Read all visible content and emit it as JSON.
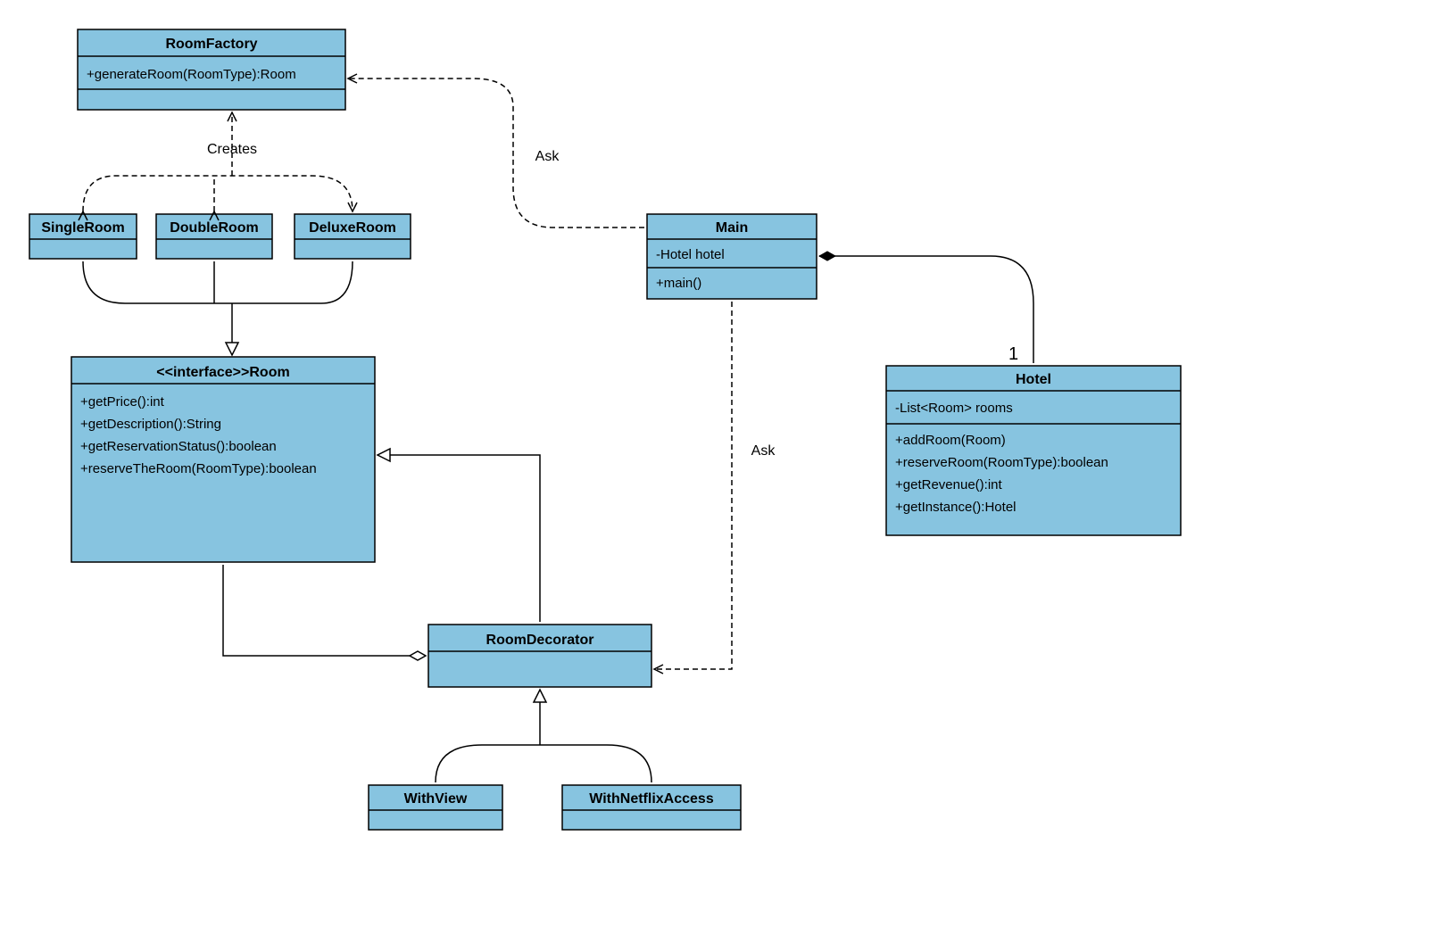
{
  "classes": {
    "roomFactory": {
      "name": "RoomFactory",
      "methods": [
        "+generateRoom(RoomType):Room"
      ]
    },
    "singleRoom": {
      "name": "SingleRoom"
    },
    "doubleRoom": {
      "name": "DoubleRoom"
    },
    "deluxeRoom": {
      "name": "DeluxeRoom"
    },
    "room": {
      "name": "<<interface>>Room",
      "methods": [
        "+getPrice():int",
        "+getDescription():String",
        "+getReservationStatus():boolean",
        "+reserveTheRoom(RoomType):boolean"
      ]
    },
    "roomDecorator": {
      "name": "RoomDecorator"
    },
    "withView": {
      "name": "WithView"
    },
    "withNetflix": {
      "name": "WithNetflixAccess"
    },
    "main": {
      "name": "Main",
      "attributes": [
        "-Hotel hotel"
      ],
      "methods": [
        "+main()"
      ]
    },
    "hotel": {
      "name": "Hotel",
      "attributes": [
        "-List<Room> rooms"
      ],
      "methods": [
        "+addRoom(Room)",
        "+reserveRoom(RoomType):boolean",
        "+getRevenue():int",
        "+getInstance():Hotel"
      ]
    }
  },
  "labels": {
    "creates": "Creates",
    "ask1": "Ask",
    "ask2": "Ask",
    "one": "1"
  }
}
